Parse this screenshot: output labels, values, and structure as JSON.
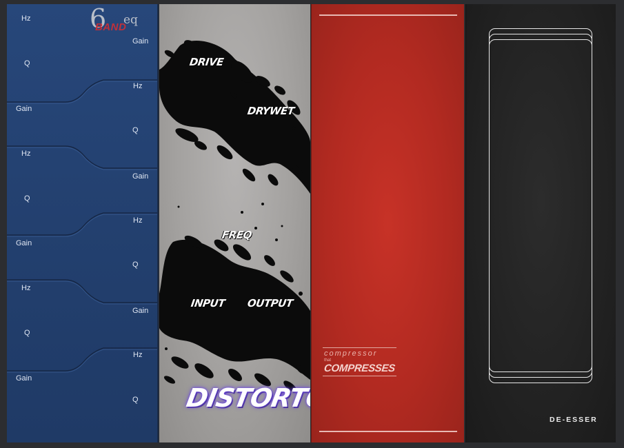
{
  "eq": {
    "logo": {
      "number": "6",
      "band": "BAND",
      "eq": "eq"
    },
    "bands": [
      {
        "hz": "Hz",
        "q": "Q",
        "gain": "Gain"
      },
      {
        "hz": "Hz",
        "q": "Q",
        "gain": "Gain"
      },
      {
        "hz": "Hz",
        "q": "Q",
        "gain": "Gain"
      },
      {
        "hz": "Hz",
        "q": "Q",
        "gain": "Gain"
      },
      {
        "hz": "Hz",
        "q": "Q",
        "gain": "Gain"
      },
      {
        "hz": "Hz",
        "q": "Q",
        "gain": "Gain"
      }
    ]
  },
  "distortor": {
    "drive": "DRIVE",
    "drywet": "DRYWET",
    "freq": "FREQ",
    "input": "INPUT",
    "output": "OUTPUT",
    "title": "DISTORTOR"
  },
  "compressor": {
    "line1": "compressor",
    "line2": "that",
    "line3": "COMPRESSES"
  },
  "deesser": {
    "label": "DE-ESSER"
  }
}
